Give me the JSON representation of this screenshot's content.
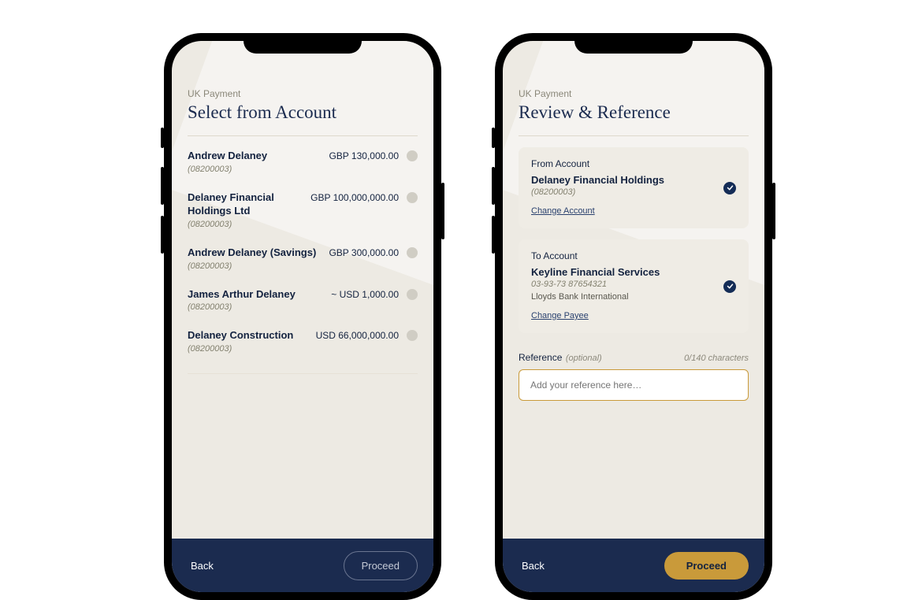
{
  "left": {
    "eyebrow": "UK Payment",
    "title": "Select from Account",
    "accounts": [
      {
        "name": "Andrew Delaney",
        "number": "(08200003)",
        "balance": "GBP 130,000.00"
      },
      {
        "name": "Delaney Financial Holdings Ltd",
        "number": "(08200003)",
        "balance": "GBP 100,000,000.00"
      },
      {
        "name": "Andrew Delaney (Savings)",
        "number": "(08200003)",
        "balance": "GBP 300,000.00"
      },
      {
        "name": "James Arthur Delaney",
        "number": "(08200003)",
        "balance": "~ USD 1,000.00"
      },
      {
        "name": "Delaney Construction",
        "number": "(08200003)",
        "balance": "USD 66,000,000.00"
      }
    ],
    "footer": {
      "back": "Back",
      "proceed": "Proceed"
    }
  },
  "right": {
    "eyebrow": "UK Payment",
    "title": "Review & Reference",
    "from": {
      "label": "From Account",
      "name": "Delaney Financial Holdings",
      "number": "(08200003)",
      "change": "Change Account"
    },
    "to": {
      "label": "To Account",
      "name": "Keyline Financial Services",
      "sort": "03-93-73   87654321",
      "bank": "Lloyds Bank International",
      "change": "Change Payee"
    },
    "reference": {
      "label": "Reference",
      "optional": "(optional)",
      "count": "0/140 characters",
      "placeholder": "Add your reference here…"
    },
    "footer": {
      "back": "Back",
      "proceed": "Proceed"
    }
  }
}
